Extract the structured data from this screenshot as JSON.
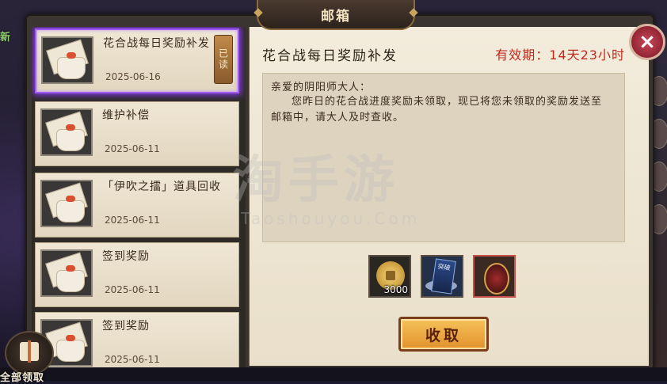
{
  "window": {
    "title": "邮箱",
    "side_left_text": "新",
    "close_icon": "×"
  },
  "mail_list": [
    {
      "title": "花合战每日奖励补发",
      "date": "2025-06-16",
      "selected": true,
      "read_tag": "已读"
    },
    {
      "title": "维护补偿",
      "date": "2025-06-11",
      "selected": false
    },
    {
      "title": "「伊吹之擂」道具回收",
      "date": "2025-06-11",
      "selected": false
    },
    {
      "title": "签到奖励",
      "date": "2025-06-11",
      "selected": false
    },
    {
      "title": "签到奖励",
      "date": "2025-06-11",
      "selected": false
    }
  ],
  "claim_all": {
    "label": "全部领取"
  },
  "detail": {
    "title": "花合战每日奖励补发",
    "validity": "有效期：14天23小时",
    "greeting": "亲爱的阴阳师大人：",
    "body": "您昨日的花合战进度奖励未领取，现已将您未领取的奖励发送至邮箱中，请大人及时查收。",
    "rewards": [
      {
        "icon": "gold-coin-icon",
        "qty": "3000"
      },
      {
        "icon": "summon-card-icon",
        "card_text": "突破"
      },
      {
        "icon": "gourd-icon"
      }
    ],
    "claim_button": "收取"
  },
  "watermark": {
    "main": "淘手游",
    "sub": "Taoshouyou.Com"
  },
  "colors": {
    "validity_red": "#c02a1e",
    "selected_glow": "#a05cf0",
    "claim_button": "#e0912c"
  }
}
